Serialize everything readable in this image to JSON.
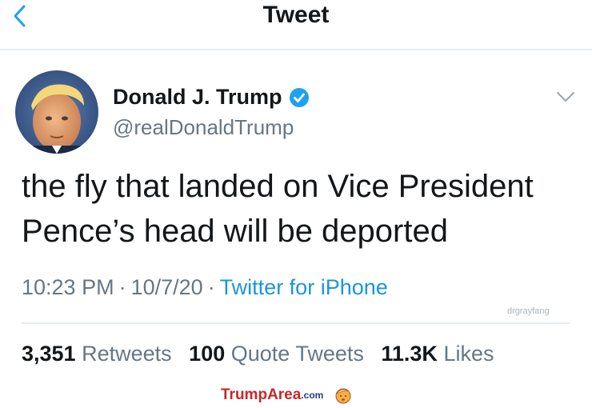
{
  "header": {
    "title": "Tweet",
    "back_icon": "chevron-left-icon"
  },
  "author": {
    "display_name": "Donald J. Trump",
    "handle": "@realDonaldTrump",
    "verified": true,
    "verified_icon": "verified-badge-icon"
  },
  "tweet": {
    "text_line1": "the fly that landed on Vice President",
    "text_line2": "Pence’s head will be deported",
    "time": "10:23 PM",
    "date": "10/7/20",
    "source": "Twitter for iPhone",
    "separator": "·"
  },
  "stats": {
    "retweets_count": "3,351",
    "retweets_label": "Retweets",
    "quotes_count": "100",
    "quotes_label": "Quote Tweets",
    "likes_count": "11.3K",
    "likes_label": "Likes"
  },
  "watermark": "drgrayfang",
  "footer": {
    "logo_trump": "Trump",
    "logo_area": "Area",
    "logo_domain": ".com",
    "icon": "trump-face-icon"
  },
  "colors": {
    "link": "#1b95e0",
    "secondary_text": "#657786",
    "verified": "#1da1f2",
    "footer_red": "#c62828",
    "footer_blue": "#1f3c88"
  }
}
